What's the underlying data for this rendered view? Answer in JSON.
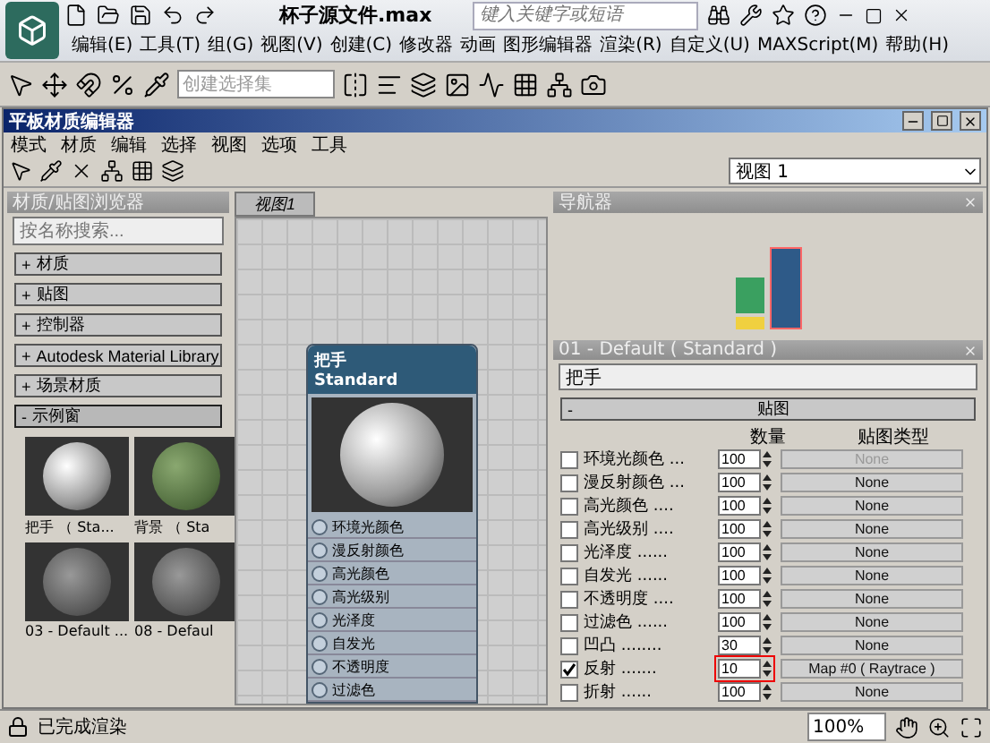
{
  "app": {
    "title": "杯子源文件.max",
    "search": {
      "placeholder": "键入关键字或短语"
    }
  },
  "menu": [
    "编辑(E)",
    "工具(T)",
    "组(G)",
    "视图(V)",
    "创建(C)",
    "修改器",
    "动画",
    "图形编辑器",
    "渲染(R)",
    "自定义(U)",
    "MAXScript(M)",
    "帮助(H)"
  ],
  "toolbar": {
    "selection_set": {
      "placeholder": "创建选择集"
    }
  },
  "editor": {
    "title": "平板材质编辑器",
    "menu": [
      "模式",
      "材质",
      "编辑",
      "选择",
      "视图",
      "选项",
      "工具"
    ],
    "view_select": "视图 1"
  },
  "browser": {
    "title": "材质/贴图浏览器",
    "search": {
      "placeholder": "按名称搜索..."
    },
    "groups": [
      {
        "toggle": "+",
        "label": "材质",
        "expanded": false
      },
      {
        "toggle": "+",
        "label": "贴图",
        "expanded": false
      },
      {
        "toggle": "+",
        "label": "控制器",
        "expanded": false
      },
      {
        "toggle": "+",
        "label": "Autodesk Material Library",
        "expanded": false
      },
      {
        "toggle": "+",
        "label": "场景材质",
        "expanded": false
      },
      {
        "toggle": "-",
        "label": "示例窗",
        "expanded": true,
        "slots": [
          {
            "label": "把手 （ Sta...",
            "kind": "chrome"
          },
          {
            "label": "背景 （ Sta",
            "kind": "green"
          },
          {
            "label": "03 - Default ...",
            "kind": "gray"
          },
          {
            "label": "08 - Defaul",
            "kind": "gray"
          }
        ]
      }
    ]
  },
  "view": {
    "tab": "视图1",
    "node": {
      "name": "把手",
      "type": "Standard",
      "slots": [
        "环境光颜色",
        "漫反射颜色",
        "高光颜色",
        "高光级别",
        "光泽度",
        "自发光",
        "不透明度",
        "过滤色"
      ]
    }
  },
  "navigator": {
    "title": "导航器"
  },
  "params": {
    "title": "01 - Default ( Standard )",
    "name": "把手",
    "rollout": {
      "toggle": "-",
      "title": "贴图"
    },
    "columns": [
      "数量",
      "贴图类型"
    ],
    "rows": [
      {
        "label": "环境光颜色 ...",
        "checked": false,
        "amount": "100",
        "map": "None",
        "disabled": true,
        "highlighted": false
      },
      {
        "label": "漫反射颜色 ...",
        "checked": false,
        "amount": "100",
        "map": "None",
        "disabled": false,
        "highlighted": false
      },
      {
        "label": "高光颜色 ....",
        "checked": false,
        "amount": "100",
        "map": "None",
        "disabled": false,
        "highlighted": false
      },
      {
        "label": "高光级别 ....",
        "checked": false,
        "amount": "100",
        "map": "None",
        "disabled": false,
        "highlighted": false
      },
      {
        "label": "光泽度 ......",
        "checked": false,
        "amount": "100",
        "map": "None",
        "disabled": false,
        "highlighted": false
      },
      {
        "label": "自发光 ......",
        "checked": false,
        "amount": "100",
        "map": "None",
        "disabled": false,
        "highlighted": false
      },
      {
        "label": "不透明度 ....",
        "checked": false,
        "amount": "100",
        "map": "None",
        "disabled": false,
        "highlighted": false
      },
      {
        "label": "过滤色 ......",
        "checked": false,
        "amount": "100",
        "map": "None",
        "disabled": false,
        "highlighted": false
      },
      {
        "label": "凹凸 ........",
        "checked": false,
        "amount": "30",
        "map": "None",
        "disabled": false,
        "highlighted": false
      },
      {
        "label": "反射 .......",
        "checked": true,
        "amount": "10",
        "map": "Map #0 ( Raytrace )",
        "disabled": false,
        "highlighted": true
      },
      {
        "label": "折射 ......",
        "checked": false,
        "amount": "100",
        "map": "None",
        "disabled": false,
        "highlighted": false
      }
    ]
  },
  "status": {
    "message": "已完成渲染",
    "zoom": "100%"
  }
}
